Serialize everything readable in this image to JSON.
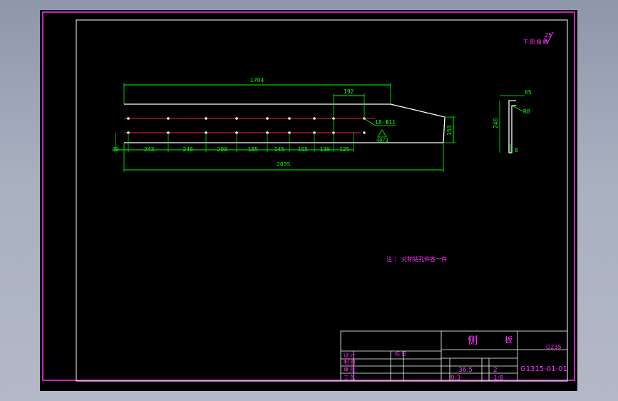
{
  "drawing": {
    "surface_finish_note": "下 图 粗 糙",
    "surface_finish_value": "25",
    "top_dims": {
      "overall_top": "1704",
      "top_right": "192"
    },
    "hole_callout": "18-Φ11",
    "hole_datum": "40/3",
    "height_dim": "153",
    "spacing": [
      "40",
      "243",
      "246",
      "200",
      "185",
      "145",
      "155",
      "130",
      "125"
    ],
    "overall_bottom": "2035",
    "section": {
      "width": "65",
      "height": "246",
      "radius": "R8",
      "thickness": "8"
    },
    "note": "注 ： 对称钻孔件各一件"
  },
  "title_block": {
    "part_name_1": "侧",
    "part_name_2": "板",
    "material": "Q235",
    "weight": "36.5",
    "qty": "2",
    "scale": "1:8",
    "sheet": "0.3",
    "drawing_no": "G1315-01-01",
    "rows": [
      "设 计",
      "制 图",
      "审 核",
      "工 艺"
    ],
    "marks": [
      "标 记"
    ]
  }
}
